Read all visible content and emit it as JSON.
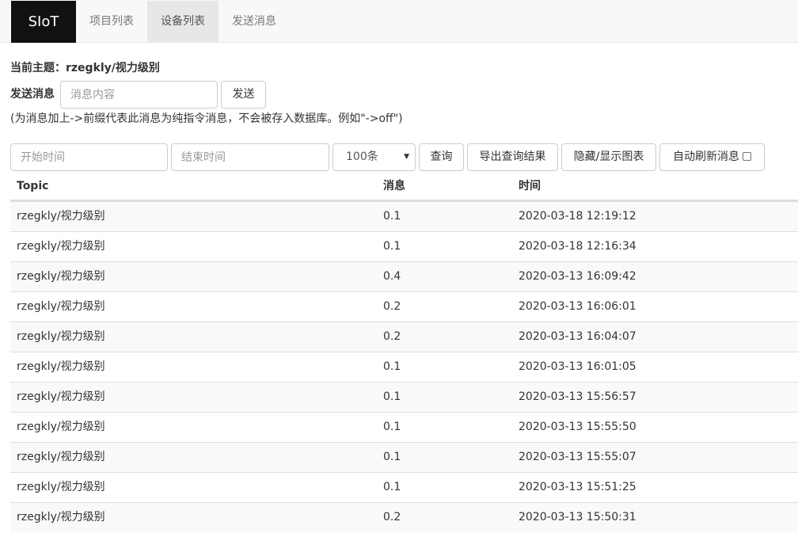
{
  "navbar": {
    "brand": "SIoT",
    "items": [
      {
        "label": "项目列表",
        "active": false
      },
      {
        "label": "设备列表",
        "active": true
      },
      {
        "label": "发送消息",
        "active": false
      }
    ]
  },
  "topic": {
    "label": "当前主题：rzegkly/视力级别"
  },
  "send": {
    "label": "发送消息",
    "placeholder": "消息内容",
    "button": "发送",
    "hint": "(为消息加上->前缀代表此消息为纯指令消息，不会被存入数据库。例如\"->off\")"
  },
  "filters": {
    "start_placeholder": "开始时间",
    "end_placeholder": "结束时间",
    "limit_value": "100条",
    "query_button": "查询",
    "export_button": "导出查询结果",
    "toggle_chart_button": "隐藏/显示图表",
    "auto_refresh_label": "自动刷新消息"
  },
  "table": {
    "headers": [
      "Topic",
      "消息",
      "时间"
    ],
    "rows": [
      [
        "rzegkly/视力级别",
        "0.1",
        "2020-03-18 12:19:12"
      ],
      [
        "rzegkly/视力级别",
        "0.1",
        "2020-03-18 12:16:34"
      ],
      [
        "rzegkly/视力级别",
        "0.4",
        "2020-03-13 16:09:42"
      ],
      [
        "rzegkly/视力级别",
        "0.2",
        "2020-03-13 16:06:01"
      ],
      [
        "rzegkly/视力级别",
        "0.2",
        "2020-03-13 16:04:07"
      ],
      [
        "rzegkly/视力级别",
        "0.1",
        "2020-03-13 16:01:05"
      ],
      [
        "rzegkly/视力级别",
        "0.1",
        "2020-03-13 15:56:57"
      ],
      [
        "rzegkly/视力级别",
        "0.1",
        "2020-03-13 15:55:50"
      ],
      [
        "rzegkly/视力级别",
        "0.1",
        "2020-03-13 15:55:07"
      ],
      [
        "rzegkly/视力级别",
        "0.1",
        "2020-03-13 15:51:25"
      ],
      [
        "rzegkly/视力级别",
        "0.2",
        "2020-03-13 15:50:31"
      ]
    ]
  }
}
